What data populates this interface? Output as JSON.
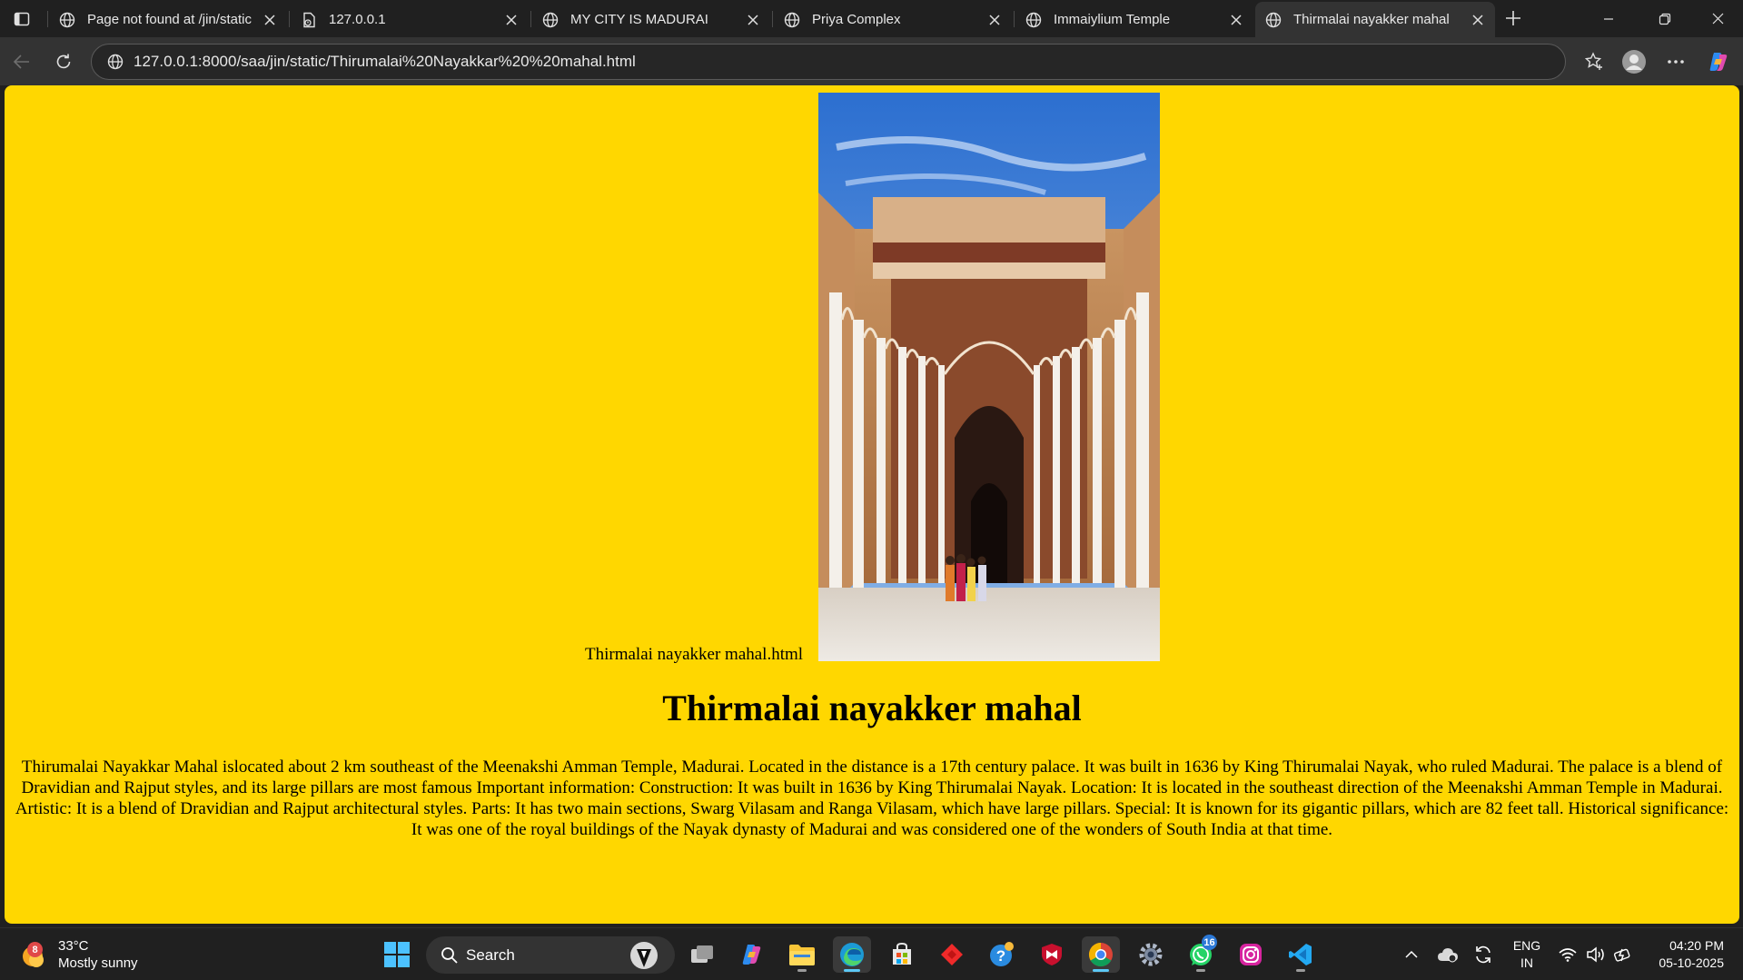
{
  "browser": {
    "tabs": [
      {
        "title": "Page not found at /jin/static",
        "favicon": "globe-icon"
      },
      {
        "title": "127.0.0.1",
        "favicon": "document-icon"
      },
      {
        "title": "MY CITY IS MADURAI",
        "favicon": "globe-icon"
      },
      {
        "title": "Priya Complex",
        "favicon": "globe-icon"
      },
      {
        "title": "Immaiylium Temple",
        "favicon": "globe-icon"
      },
      {
        "title": "Thirmalai nayakker mahal",
        "favicon": "globe-icon",
        "active": true
      }
    ],
    "address_url": "127.0.0.1:8000/saa/jin/static/Thirumalai%20Nayakkar%20%20mahal.html"
  },
  "page": {
    "image_alt": "Thirmalai nayakker mahal.html",
    "heading": "Thirmalai nayakker mahal",
    "paragraph": "Thirumalai Nayakkar Mahal islocated about 2 km southeast of the Meenakshi Amman Temple, Madurai. Located in the distance is a 17th century palace. It was built in 1636 by King Thirumalai Nayak, who ruled Madurai. The palace is a blend of Dravidian and Rajput styles, and its large pillars are most famous Important information: Construction: It was built in 1636 by King Thirumalai Nayak. Location: It is located in the southeast direction of the Meenakshi Amman Temple in Madurai. Artistic: It is a blend of Dravidian and Rajput architectural styles. Parts: It has two main sections, Swarg Vilasam and Ranga Vilasam, which have large pillars. Special: It is known for its gigantic pillars, which are 82 feet tall. Historical significance: It was one of the royal buildings of the Nayak dynasty of Madurai and was considered one of the wonders of South India at that time.",
    "background_color": "#ffd700"
  },
  "taskbar": {
    "weather_temp": "33°C",
    "weather_desc": "Mostly sunny",
    "weather_badge": "8",
    "search_label": "Search",
    "whatsapp_badge": "16",
    "lang_line1": "ENG",
    "lang_line2": "IN",
    "time": "04:20 PM",
    "date": "05-10-2025"
  }
}
